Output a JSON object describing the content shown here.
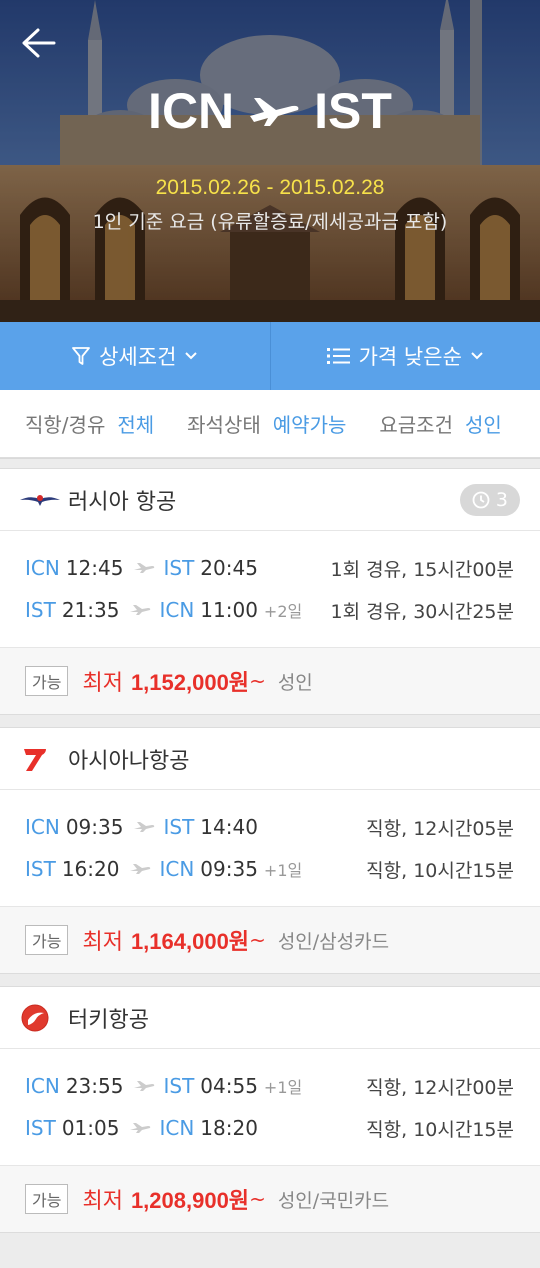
{
  "header": {
    "origin": "ICN",
    "destination": "IST",
    "dates": "2015.02.26 - 2015.02.28",
    "fare_note": "1인 기준 요금 (유류할증료/제세공과금 포함)"
  },
  "filters": {
    "detail_label": "상세조건",
    "sort_label": "가격 낮은순"
  },
  "chips": [
    {
      "label": "직항/경유",
      "value": "전체"
    },
    {
      "label": "좌석상태",
      "value": "예약가능"
    },
    {
      "label": "요금조건",
      "value": "성인"
    }
  ],
  "results": [
    {
      "airline": "러시아 항공",
      "badge_count": "3",
      "legs": [
        {
          "from": "ICN",
          "dep": "12:45",
          "to": "IST",
          "arr": "20:45",
          "plus": "",
          "info": "1회 경유, 15시간00분"
        },
        {
          "from": "IST",
          "dep": "21:35",
          "to": "ICN",
          "arr": "11:00",
          "plus": "+2일",
          "info": "1회 경유, 30시간25분"
        }
      ],
      "avail": "가능",
      "price_prefix": "최저",
      "price": "1,152,000원",
      "price_suffix": "~",
      "pax": "성인"
    },
    {
      "airline": "아시아나항공",
      "legs": [
        {
          "from": "ICN",
          "dep": "09:35",
          "to": "IST",
          "arr": "14:40",
          "plus": "",
          "info": "직항, 12시간05분"
        },
        {
          "from": "IST",
          "dep": "16:20",
          "to": "ICN",
          "arr": "09:35",
          "plus": "+1일",
          "info": "직항, 10시간15분"
        }
      ],
      "avail": "가능",
      "price_prefix": "최저",
      "price": "1,164,000원",
      "price_suffix": "~",
      "pax": "성인/삼성카드"
    },
    {
      "airline": "터키항공",
      "legs": [
        {
          "from": "ICN",
          "dep": "23:55",
          "to": "IST",
          "arr": "04:55",
          "plus": "+1일",
          "info": "직항, 12시간00분"
        },
        {
          "from": "IST",
          "dep": "01:05",
          "to": "ICN",
          "arr": "18:20",
          "plus": "",
          "info": "직항, 10시간15분"
        }
      ],
      "avail": "가능",
      "price_prefix": "최저",
      "price": "1,208,900원",
      "price_suffix": "~",
      "pax": "성인/국민카드"
    }
  ],
  "colors": {
    "accent": "#5aa2ea",
    "link": "#4a9be4",
    "price": "#e8302a",
    "dates": "#f7e24a"
  }
}
